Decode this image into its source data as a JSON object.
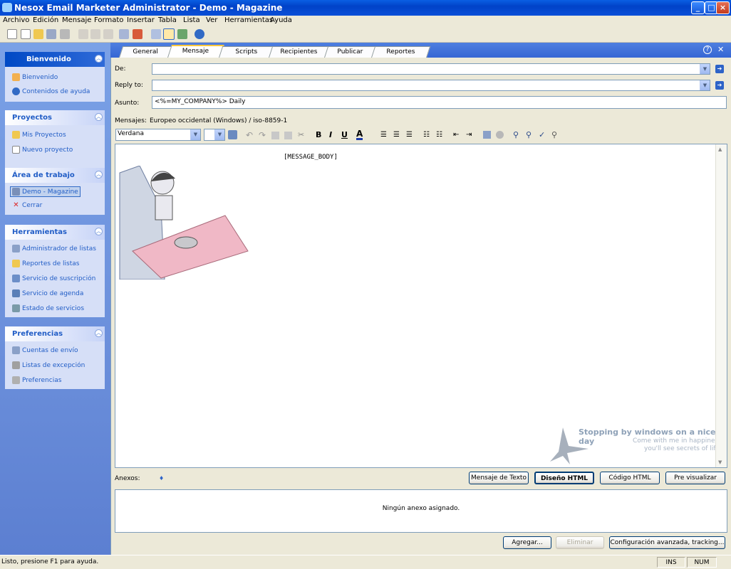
{
  "window": {
    "title": "Nesox Email Marketer Administrator - Demo - Magazine",
    "min": "_",
    "max": "□",
    "close": "×"
  },
  "menu": [
    "Archivo",
    "Edición",
    "Mensaje",
    "Formato",
    "Insertar",
    "Tabla",
    "Lista",
    "Ver",
    "Herramientas",
    "Ayuda"
  ],
  "sidebar": {
    "groups": [
      {
        "title": "Bienvenido",
        "items": [
          "Bienvenido",
          "Contenidos de ayuda"
        ]
      },
      {
        "title": "Proyectos",
        "items": [
          "Mis Proyectos",
          "Nuevo proyecto"
        ]
      },
      {
        "title": "Área de trabajo",
        "items": [
          "Demo - Magazine",
          "Cerrar"
        ]
      },
      {
        "title": "Herramientas",
        "items": [
          "Administrador de listas",
          "Reportes de listas",
          "Servicio de suscripción",
          "Servicio de agenda",
          "Estado de servicios"
        ]
      },
      {
        "title": "Preferencias",
        "items": [
          "Cuentas de envío",
          "Listas de excepción",
          "Preferencias"
        ]
      }
    ]
  },
  "tabs": [
    "General",
    "Mensaje",
    "Scripts",
    "Recipientes",
    "Publicar",
    "Reportes"
  ],
  "active_tab": "Mensaje",
  "form": {
    "de_label": "De:",
    "de_value": "",
    "reply_label": "Reply to:",
    "reply_value": "",
    "asunto_label": "Asunto:",
    "asunto_value": "<%=MY_COMPANY%> Daily",
    "mensajes_label": "Mensajes:",
    "encoding": "Europeo occidental (Windows) / iso-8859-1",
    "font": "Verdana"
  },
  "editor": {
    "body": "[MESSAGE_BODY]",
    "overlay_title": "Stopping by windows on a nice day",
    "overlay_line1": "Come with me in happiness",
    "overlay_line2": "you'll see secrets of life."
  },
  "view_buttons": [
    "Mensaje de Texto",
    "Diseño HTML",
    "Código HTML",
    "Pre visualizar"
  ],
  "anexos_label": "Anexos:",
  "anexos_empty": "Ningún anexo asignado.",
  "bottom_buttons": [
    "Agregar...",
    "Eliminar",
    "Configuración avanzada, tracking..."
  ],
  "status": {
    "text": "Listo, presione F1 para ayuda.",
    "ins": "INS",
    "num": "NUM"
  }
}
